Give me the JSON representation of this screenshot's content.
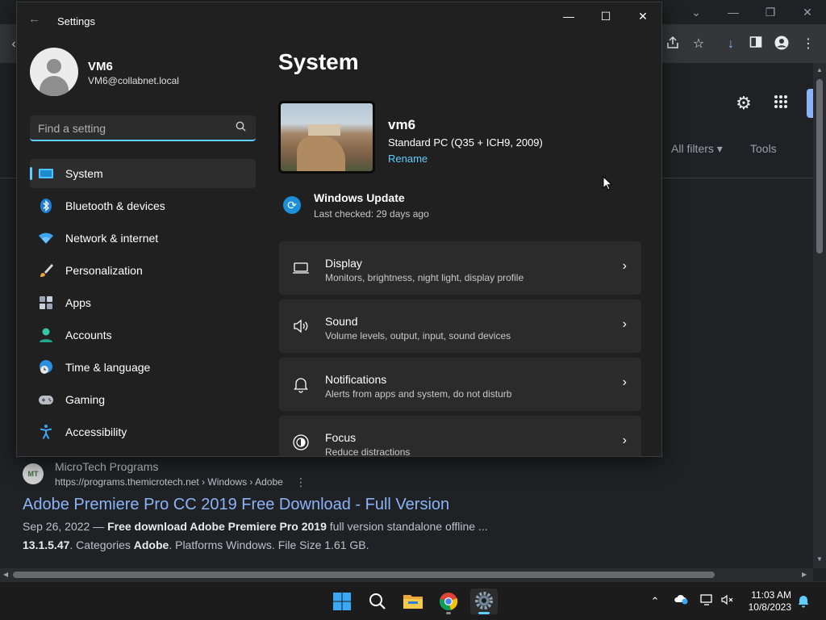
{
  "browser": {
    "toolbar_icons": [
      "share-icon",
      "star-icon",
      "download-icon",
      "sidepanel-icon",
      "profile-icon",
      "kebab-menu-icon"
    ],
    "google": {
      "settings_icon": "gear-icon",
      "apps_icon": "apps-grid-icon",
      "all_filters": "All filters",
      "tools": "Tools"
    },
    "result": {
      "favicon_text": "MT",
      "site_name": "MicroTech Programs",
      "url": "https://programs.themicrotech.net › Windows › Adobe",
      "title": "Adobe Premiere Pro CC 2019 Free Download - Full Version",
      "snippet1_date": "Sep 26, 2022 — ",
      "snippet1_bold": "Free download Adobe Premiere Pro 2019",
      "snippet1_rest": " full version standalone offline ...",
      "snippet2_bold1": "13.1.5.47",
      "snippet2_mid": ". Categories ",
      "snippet2_bold2": "Adobe",
      "snippet2_rest": ". Platforms Windows. File Size 1.61 GB."
    }
  },
  "settings": {
    "window_title": "Settings",
    "user": {
      "name": "VM6",
      "email": "VM6@collabnet.local"
    },
    "search": {
      "placeholder": "Find a setting"
    },
    "nav": [
      {
        "label": "System",
        "icon": "system-display-icon",
        "active": true
      },
      {
        "label": "Bluetooth & devices",
        "icon": "bluetooth-icon"
      },
      {
        "label": "Network & internet",
        "icon": "wifi-icon"
      },
      {
        "label": "Personalization",
        "icon": "brush-icon"
      },
      {
        "label": "Apps",
        "icon": "apps-icon"
      },
      {
        "label": "Accounts",
        "icon": "person-icon"
      },
      {
        "label": "Time & language",
        "icon": "globe-clock-icon"
      },
      {
        "label": "Gaming",
        "icon": "gamepad-icon"
      },
      {
        "label": "Accessibility",
        "icon": "accessibility-icon"
      }
    ],
    "page_title": "System",
    "device": {
      "name": "vm6",
      "model": "Standard PC (Q35 + ICH9, 2009)",
      "rename": "Rename"
    },
    "windows_update": {
      "title": "Windows Update",
      "status": "Last checked: 29 days ago"
    },
    "cards": [
      {
        "title": "Display",
        "subtitle": "Monitors, brightness, night light, display profile",
        "icon": "monitor-icon"
      },
      {
        "title": "Sound",
        "subtitle": "Volume levels, output, input, sound devices",
        "icon": "speaker-icon"
      },
      {
        "title": "Notifications",
        "subtitle": "Alerts from apps and system, do not disturb",
        "icon": "bell-icon"
      },
      {
        "title": "Focus",
        "subtitle": "Reduce distractions",
        "icon": "focus-icon"
      }
    ]
  },
  "taskbar": {
    "apps": [
      "start-icon",
      "search-icon",
      "file-explorer-icon",
      "chrome-icon",
      "settings-gear-icon"
    ],
    "active_app": "settings-gear-icon",
    "time": "11:03 AM",
    "date": "10/8/2023"
  },
  "colors": {
    "accent": "#60cdff",
    "link": "#8ab4f8",
    "settings_bg": "#202020",
    "card_bg": "#2b2b2b"
  }
}
